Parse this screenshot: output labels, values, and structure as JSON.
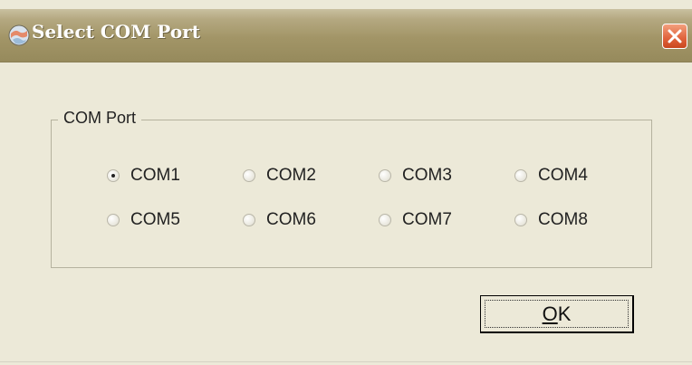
{
  "window": {
    "title": "Select COM Port",
    "title_icon": "globe-icon",
    "close_icon": "close-icon"
  },
  "group": {
    "label": "COM Port"
  },
  "ports": [
    {
      "label": "COM1",
      "checked": true
    },
    {
      "label": "COM2",
      "checked": false
    },
    {
      "label": "COM3",
      "checked": false
    },
    {
      "label": "COM4",
      "checked": false
    },
    {
      "label": "COM5",
      "checked": false
    },
    {
      "label": "COM6",
      "checked": false
    },
    {
      "label": "COM7",
      "checked": false
    },
    {
      "label": "COM8",
      "checked": false
    }
  ],
  "buttons": {
    "ok_mnemonic": "O",
    "ok_rest": "K"
  },
  "colors": {
    "dialog_bg": "#ece9d8",
    "close_button": "#e0623b"
  }
}
